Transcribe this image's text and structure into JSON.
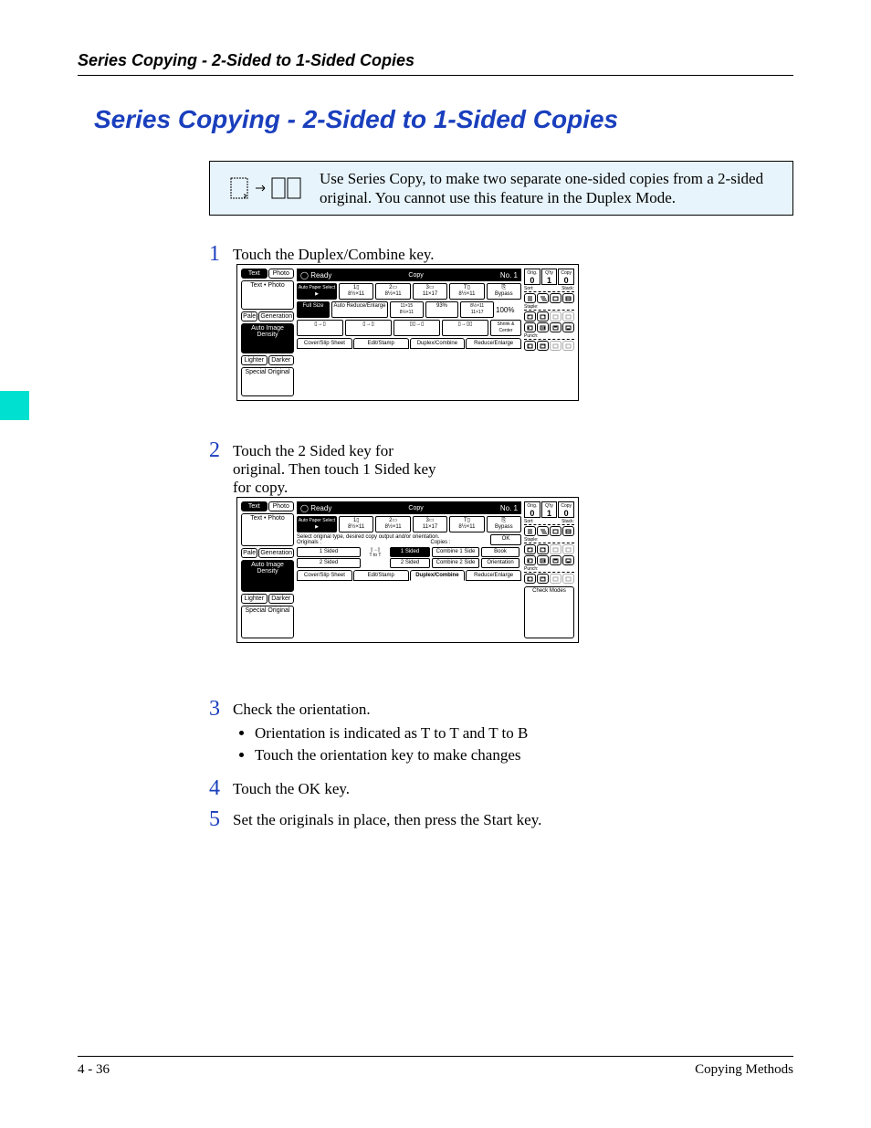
{
  "header": {
    "running": "Series Copying - 2-Sided to 1-Sided Copies"
  },
  "title": "Series Copying - 2-Sided to 1-Sided Copies",
  "info": {
    "text": "Use Series Copy, to make two separate one-sided copies from a 2-sided original. You cannot use this feature in the Duplex Mode."
  },
  "steps": {
    "s1": {
      "n": "1",
      "text": "Touch the Duplex/Combine key."
    },
    "s2": {
      "n": "2",
      "text": "Touch the 2 Sided key for original. Then touch 1 Sided key for copy."
    },
    "s3": {
      "n": "3",
      "text": "Check the orientation.",
      "bullets": [
        "Orientation is indicated as T to T and T to B",
        "Touch the orientation key to make changes"
      ]
    },
    "s4": {
      "n": "4",
      "text": "Touch the OK key."
    },
    "s5": {
      "n": "5",
      "text": "Set the originals in place, then press the Start key."
    }
  },
  "panel_common": {
    "ready": "Ready",
    "copy_lbl": "Copy",
    "job_no": "No. 1",
    "left": {
      "text": "Text",
      "photo": "Photo",
      "text_photo": "Text • Photo",
      "pale": "Pale",
      "generation": "Generation",
      "auto_density": "Auto Image Density",
      "lighter": "Lighter",
      "darker": "Darker",
      "special": "Special Original"
    },
    "paper": {
      "auto_paper": "Auto Paper Select ▶",
      "t1_a": "1",
      "t1_b": "8½×11",
      "t2_a": "2",
      "t2_b": "8½×11",
      "t3_a": "3",
      "t3_b": "11×17",
      "t4_a": "T",
      "t4_b": "8½×11",
      "bypass": "Bypass"
    },
    "zoom": {
      "full": "Full Size",
      "auto": "Auto Reduce/Enlarge",
      "r1a": "11×15",
      "r1b": "8½×11",
      "pct1": "93%",
      "r2a": "8½×11",
      "r2b": "11×17",
      "pct_main": "100%"
    },
    "shrink_center": "Shrink & Center",
    "tabs": {
      "cover": "Cover/Slip Sheet",
      "edit": "Edit/Stamp",
      "duplex": "Duplex/Combine",
      "reduce": "Reduce/Enlarge"
    },
    "right": {
      "orig": "Orig.",
      "qty": "Q'ty",
      "copy": "Copy",
      "orig_v": "0",
      "qty_v": "1",
      "copy_v": "0",
      "sort": "Sort:",
      "stack": "Stack:",
      "staple": "Staple:",
      "punch": "Punch:",
      "check": "Check Modes"
    }
  },
  "panel2": {
    "msg": "Select original type, desired copy output and/or orientation.",
    "originals": "Originals :",
    "copies": "Copies :",
    "one_sided": "1 Sided",
    "two_sided": "2 Sided",
    "t_to_t": "T to T",
    "cp_one": "1 Sided",
    "cp_two": "2 Sided",
    "combine1": "Combine 1 Side",
    "combine2": "Combine 2 Side",
    "book": "Book",
    "orientation": "Orientation",
    "ok": "OK"
  },
  "footer": {
    "left": "4 - 36",
    "right": "Copying Methods"
  }
}
